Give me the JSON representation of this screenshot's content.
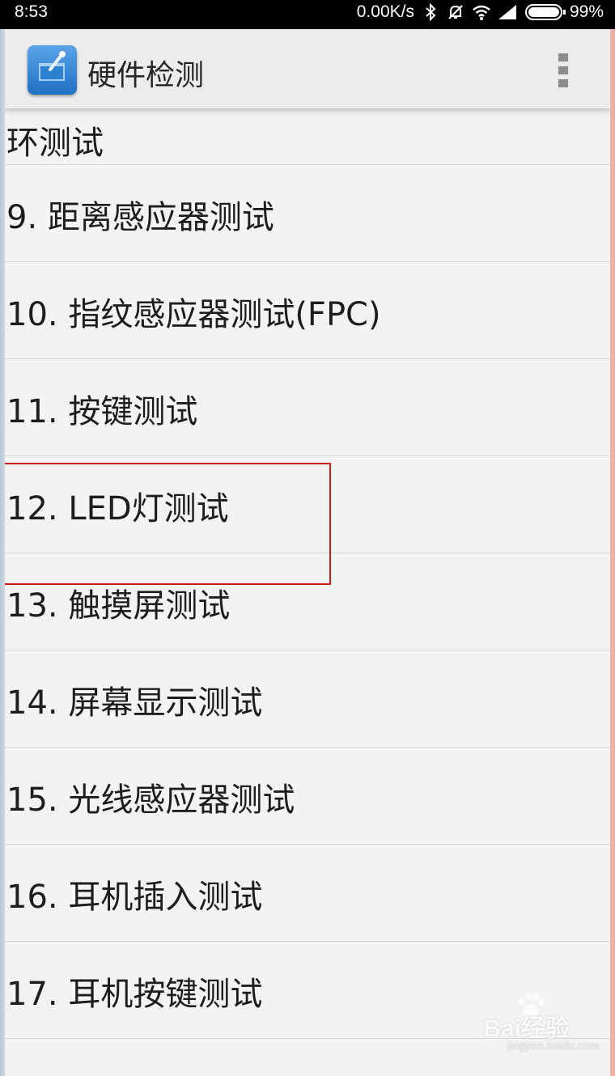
{
  "status_bar": {
    "time": "8:53",
    "speed": "0.00K/s",
    "battery": "99%"
  },
  "app_bar": {
    "title": "硬件检测",
    "icon": "hardware-test-app-icon",
    "menu_icon": "overflow-menu-icon"
  },
  "list": {
    "partial_item": "环测试",
    "items": [
      {
        "label": "9. 距离感应器测试"
      },
      {
        "label": "10. 指纹感应器测试(FPC)"
      },
      {
        "label": "11. 按键测试"
      },
      {
        "label": "12. LED灯测试"
      },
      {
        "label": "13. 触摸屏测试"
      },
      {
        "label": "14. 屏幕显示测试"
      },
      {
        "label": "15. 光线感应器测试"
      },
      {
        "label": "16. 耳机插入测试"
      },
      {
        "label": "17. 耳机按键测试"
      }
    ]
  },
  "watermark": {
    "main": "Bai经验",
    "sub": "jingyan.baidu.com"
  },
  "colors": {
    "status_bar_bg": "#000000",
    "app_bar_bg": "#ececec",
    "list_bg": "#f3f3f3",
    "highlight_border": "#c81c1c"
  }
}
